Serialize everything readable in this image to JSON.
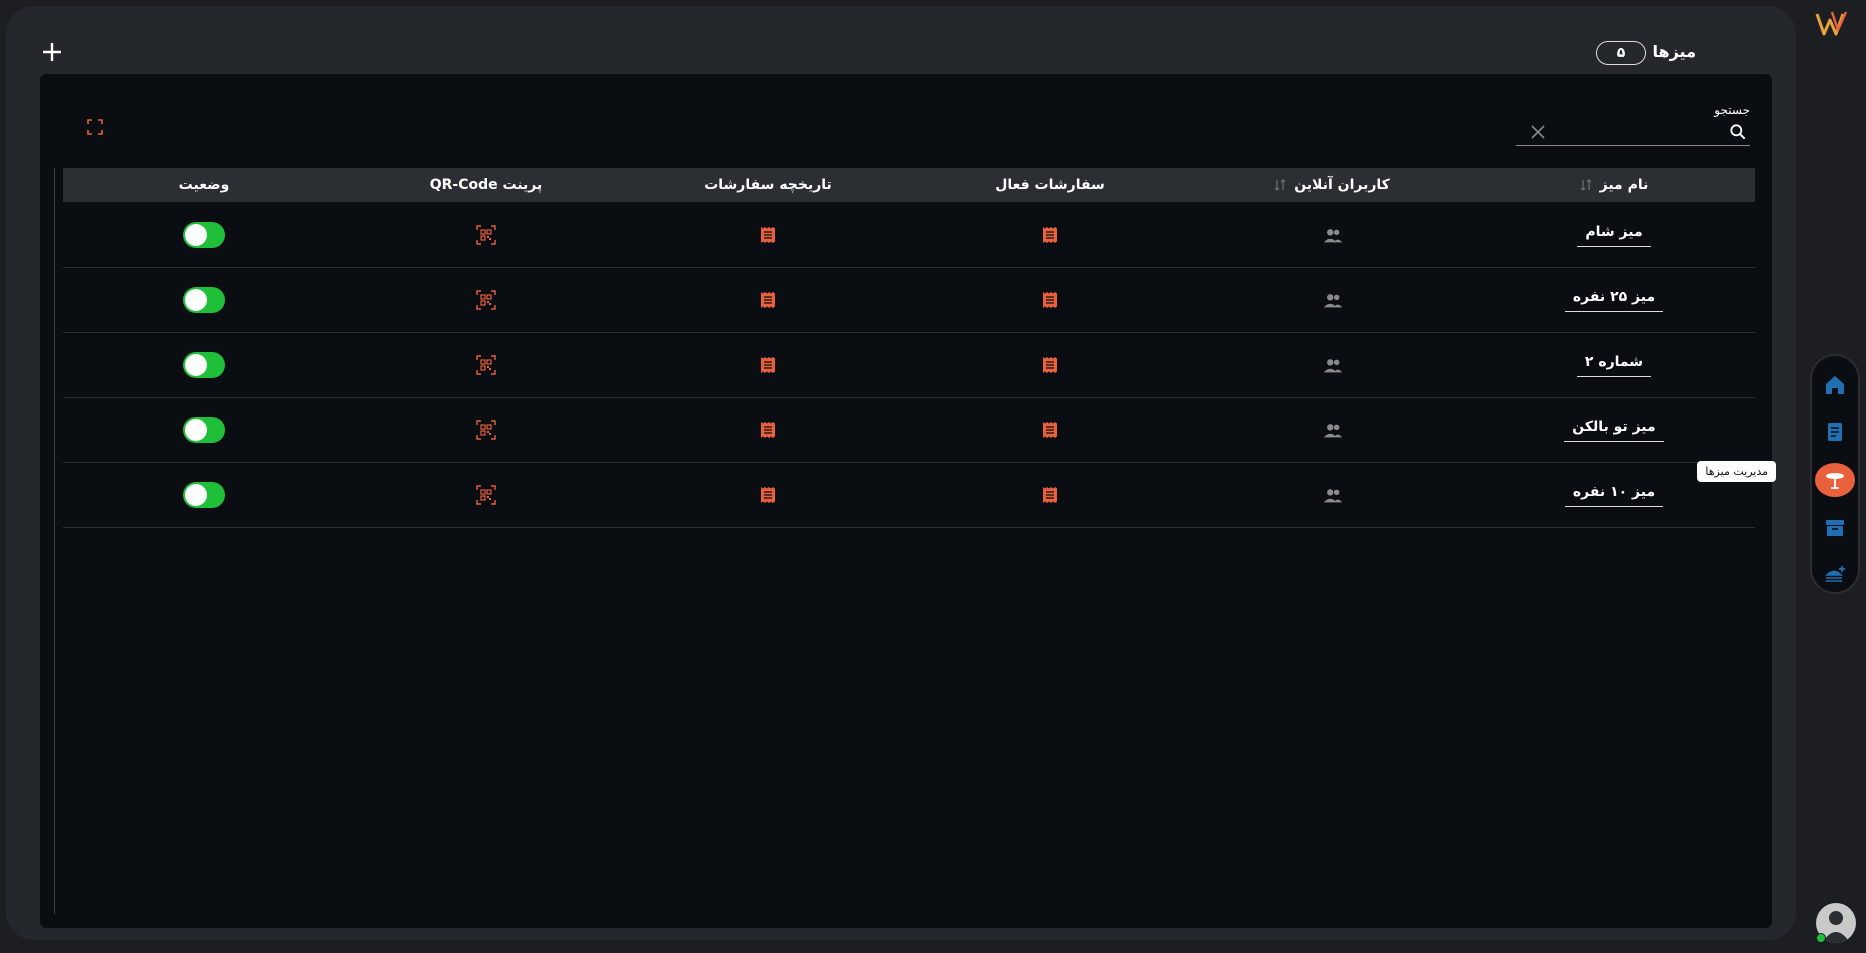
{
  "header": {
    "title": "میزها",
    "count": "۵"
  },
  "search": {
    "label": "جستجو",
    "value": ""
  },
  "table": {
    "columns": {
      "name": "نام میز",
      "online_users": "کاربران آنلاین",
      "active_orders": "سفارشات فعال",
      "order_history": "تاریخچه سفارشات",
      "print_qr": "پرینت QR-Code",
      "status": "وضعیت"
    },
    "rows": [
      {
        "name": "میز شام",
        "status": "on"
      },
      {
        "name": "میز ۲۵ نفره",
        "status": "on"
      },
      {
        "name": "شماره ۲",
        "status": "on"
      },
      {
        "name": "میز تو بالکن",
        "status": "on"
      },
      {
        "name": "میز ۱۰ نفره",
        "status": "on"
      }
    ]
  },
  "sidebar": {
    "tooltip": "مدیریت میزها",
    "items": [
      {
        "icon": "home-icon"
      },
      {
        "icon": "menu-book-icon"
      },
      {
        "icon": "table-icon",
        "active": true
      },
      {
        "icon": "archive-icon"
      },
      {
        "icon": "food-add-icon"
      }
    ]
  },
  "colors": {
    "accent": "#e8603c",
    "nav_icon": "#1f6fb2",
    "toggle_on": "#1fbf3a",
    "background": "#0a0d12"
  }
}
